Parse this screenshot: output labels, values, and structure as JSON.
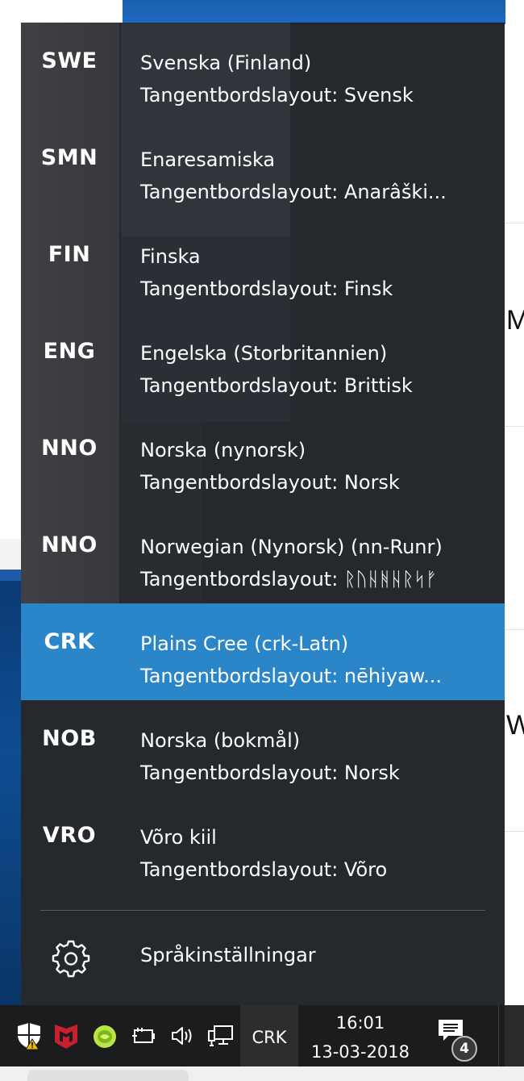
{
  "flyout": {
    "languages": [
      {
        "code": "SWE",
        "name": "Svenska (Finland)",
        "layout": "Tangentbordslayout: Svensk",
        "selected": false
      },
      {
        "code": "SMN",
        "name": "Enaresamiska",
        "layout": "Tangentbordslayout: Anarâški...",
        "selected": false
      },
      {
        "code": "FIN",
        "name": "Finska",
        "layout": "Tangentbordslayout: Finsk",
        "selected": false
      },
      {
        "code": "ENG",
        "name": "Engelska (Storbritannien)",
        "layout": "Tangentbordslayout: Brittisk",
        "selected": false
      },
      {
        "code": "NNO",
        "name": "Norska (nynorsk)",
        "layout": "Tangentbordslayout: Norsk",
        "selected": false
      },
      {
        "code": "NNO",
        "name": "Norwegian (Nynorsk) (nn-Runr)",
        "layout": "Tangentbordslayout: ᚱᚢᚺᚻᚺᚱᛋᚠ",
        "selected": false
      },
      {
        "code": "CRK",
        "name": "Plains Cree (crk-Latn)",
        "layout": "Tangentbordslayout: nēhiyaw...",
        "selected": true
      },
      {
        "code": "NOB",
        "name": "Norska (bokmål)",
        "layout": "Tangentbordslayout: Norsk",
        "selected": false
      },
      {
        "code": "VRO",
        "name": "Võro kiil",
        "layout": "Tangentbordslayout: Võro",
        "selected": false
      }
    ],
    "settings_label": "Språkinställningar",
    "settings_icon": "gear-icon"
  },
  "taskbar": {
    "tray_icons": [
      "windows-defender-warning-icon",
      "mcafee-icon",
      "lime-app-icon",
      "power-plug-icon",
      "volume-icon",
      "network-icon"
    ],
    "language_indicator": "CRK",
    "time": "16:01",
    "date": "13-03-2018",
    "notification_count": "4"
  },
  "colors": {
    "flyout_bg": "#1e2126",
    "selected_bg": "#2b86c9",
    "taskbar_bg": "#1b1c1e"
  },
  "background": {
    "right_edge_text_1": "MB",
    "right_edge_text_2": "W"
  }
}
